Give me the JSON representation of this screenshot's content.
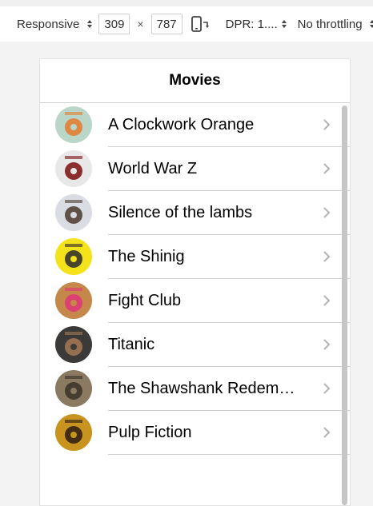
{
  "devtools": {
    "device_label": "Responsive",
    "width": "309",
    "height": "787",
    "times": "×",
    "dpr_label": "DPR: 1....",
    "throttle_label": "No throttling"
  },
  "app": {
    "title": "Movies",
    "movies": [
      {
        "title": "A Clockwork Orange",
        "poster_bg": "#b9d6c9",
        "poster_fg": "#e57a2b",
        "poster_icon": "clockwork-orange-poster"
      },
      {
        "title": "World War Z",
        "poster_bg": "#e8e8e8",
        "poster_fg": "#7a0d0d",
        "poster_icon": "world-war-z-poster"
      },
      {
        "title": "Silence of the lambs",
        "poster_bg": "#d9dce3",
        "poster_fg": "#4a3a2c",
        "poster_icon": "silence-of-the-lambs-poster"
      },
      {
        "title": "The Shinig",
        "poster_bg": "#f4e21a",
        "poster_fg": "#2a2a2a",
        "poster_icon": "the-shining-poster"
      },
      {
        "title": "Fight Club",
        "poster_bg": "#c6884a",
        "poster_fg": "#e0357a",
        "poster_icon": "fight-club-poster"
      },
      {
        "title": "Titanic",
        "poster_bg": "#3c3a38",
        "poster_fg": "#a57a55",
        "poster_icon": "titanic-poster"
      },
      {
        "title": "The Shawshank Redem…",
        "poster_bg": "#8a7a62",
        "poster_fg": "#3a3226",
        "poster_icon": "shawshank-redemption-poster"
      },
      {
        "title": "Pulp Fiction",
        "poster_bg": "#c9931f",
        "poster_fg": "#2b1a10",
        "poster_icon": "pulp-fiction-poster"
      }
    ]
  }
}
